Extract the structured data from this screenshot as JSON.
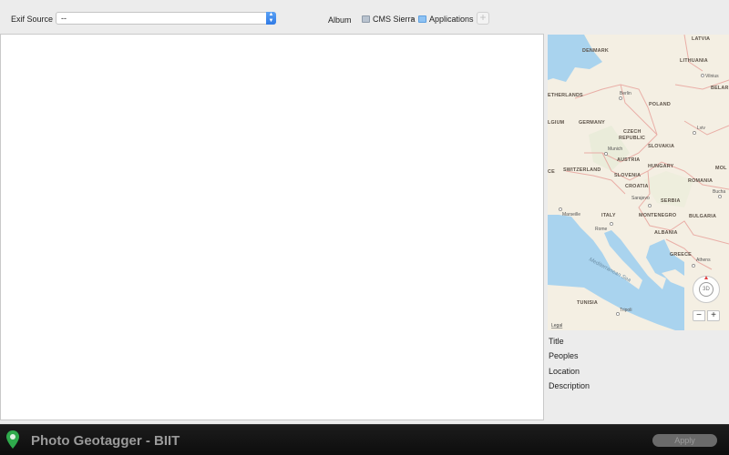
{
  "toolbar": {
    "exif_source_label": "Exif Source",
    "exif_source_value": "--",
    "album_label": "Album",
    "breadcrumb": [
      "CMS Sierra",
      "Applications"
    ],
    "breadcrumb_separator": "›",
    "add_symbol": "+"
  },
  "map": {
    "countries": [
      "DENMARK",
      "LATVIA",
      "LITHUANIA",
      "BELAR",
      "ETHERLANDS",
      "POLAND",
      "LGIUM",
      "GERMANY",
      "CZECH",
      "REPUBLIC",
      "SLOVAKIA",
      "MOL",
      "CE",
      "SWITZERLAND",
      "AUSTRIA",
      "HUNGARY",
      "SLOVENIA",
      "CROATIA",
      "ROMANIA",
      "ITALY",
      "SERBIA",
      "MONTENEGRO",
      "BULGARIA",
      "ALBANIA",
      "GREECE",
      "TUNISIA"
    ],
    "cities": [
      "Vilnius",
      "Berlin",
      "Lviv",
      "Munich",
      "Bucha",
      "Sarajevo",
      "Marseille",
      "Rome",
      "Athens",
      "Tripoli"
    ],
    "sea": "Mediterranean Sea",
    "legal": "Legal",
    "compass_label": "3D",
    "zoom_out": "−",
    "zoom_in": "+"
  },
  "metadata_fields": {
    "title": "Title",
    "peoples": "Peoples",
    "location": "Location",
    "description": "Description"
  },
  "footer": {
    "app_title": "Photo Geotagger - BIIT",
    "apply_label": "Apply"
  },
  "colors": {
    "accent": "#2f7ae5",
    "water": "#a9d3ee",
    "land": "#f4efe3",
    "border": "#e8a7a0",
    "footer_bg": "#111111"
  }
}
